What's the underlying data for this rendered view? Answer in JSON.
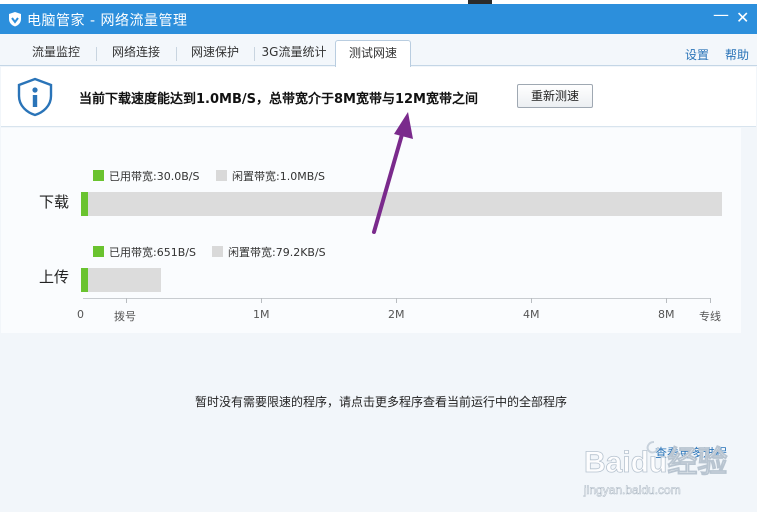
{
  "window": {
    "title": "电脑管家 - 网络流量管理",
    "minimize_glyph": "—",
    "close_glyph": "✕"
  },
  "tabs": [
    {
      "label": "流量监控",
      "active": false
    },
    {
      "label": "网络连接",
      "active": false
    },
    {
      "label": "网速保护",
      "active": false
    },
    {
      "label": "3G流量统计",
      "active": false
    },
    {
      "label": "测试网速",
      "active": true
    }
  ],
  "top_links": {
    "settings": "设置",
    "help": "帮助"
  },
  "notice": {
    "message": "当前下载速度能达到1.0MB/S，总带宽介于8M宽带与12M宽带之间",
    "retest_button": "重新测速"
  },
  "speed": {
    "download": {
      "label": "下载",
      "used_text": "已用带宽:30.0B/S",
      "idle_text": "闲置带宽:1.0MB/S",
      "used_fraction": 0.01
    },
    "upload": {
      "label": "上传",
      "used_text": "已用带宽:651B/S",
      "idle_text": "闲置带宽:79.2KB/S",
      "used_fraction": 0.09
    },
    "axis_ticks": [
      "0",
      "拨号",
      "1M",
      "2M",
      "4M",
      "8M",
      "专线"
    ]
  },
  "program_list": {
    "empty_message": "暂时没有需要限速的程序，请点击更多程序查看当前运行中的全部程序",
    "more_link": "查看更多进程"
  },
  "watermark": {
    "text": "Baidu经验",
    "url_text": "jingyan.baidu.com"
  },
  "colors": {
    "titlebar": "#2c8fdc",
    "used_bandwidth": "#6ac32f",
    "idle_bandwidth": "#dcdcdc",
    "link": "#2a74b8",
    "annotation_arrow": "#7a2a8c"
  },
  "icons": [
    "shield-logo-icon",
    "info-shield-icon"
  ]
}
